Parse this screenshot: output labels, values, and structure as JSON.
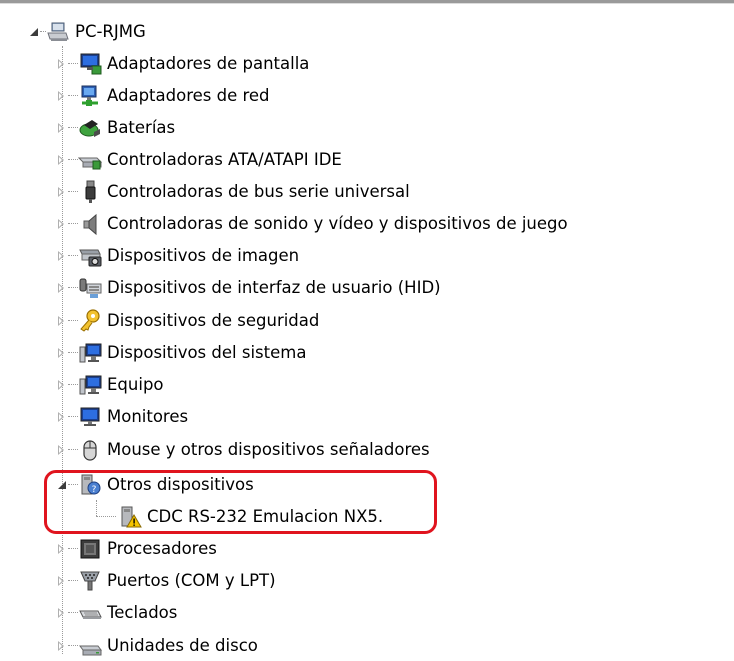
{
  "tree": {
    "root": {
      "label": "PC-RJMG",
      "icon": "computer-icon"
    },
    "categories": [
      {
        "label": "Adaptadores de pantalla",
        "icon": "display-adapter-icon"
      },
      {
        "label": "Adaptadores de red",
        "icon": "network-adapter-icon"
      },
      {
        "label": "Baterías",
        "icon": "battery-icon"
      },
      {
        "label": "Controladoras ATA/ATAPI IDE",
        "icon": "ide-controller-icon"
      },
      {
        "label": "Controladoras de bus serie universal",
        "icon": "usb-icon"
      },
      {
        "label": "Controladoras de sonido y vídeo y dispositivos de juego",
        "icon": "speaker-icon"
      },
      {
        "label": "Dispositivos de imagen",
        "icon": "camera-icon"
      },
      {
        "label": "Dispositivos de interfaz de usuario (HID)",
        "icon": "hid-icon"
      },
      {
        "label": "Dispositivos de seguridad",
        "icon": "key-icon"
      },
      {
        "label": "Dispositivos del sistema",
        "icon": "system-device-icon"
      },
      {
        "label": "Equipo",
        "icon": "computer-icon"
      },
      {
        "label": "Monitores",
        "icon": "monitor-icon"
      },
      {
        "label": "Mouse y otros dispositivos señaladores",
        "icon": "mouse-icon"
      },
      {
        "label": "Otros dispositivos",
        "icon": "unknown-device-icon",
        "expanded": true
      },
      {
        "label": "Procesadores",
        "icon": "processor-icon"
      },
      {
        "label": "Puertos (COM y LPT)",
        "icon": "port-icon"
      },
      {
        "label": "Teclados",
        "icon": "keyboard-icon"
      },
      {
        "label": "Unidades de disco",
        "icon": "disk-drive-icon"
      }
    ],
    "other_devices_child": {
      "label": "CDC RS-232 Emulacion NX5.",
      "icon": "warning-device-icon"
    }
  },
  "colors": {
    "highlight": "#e0141e",
    "warning": "#f5c400",
    "expander": "#b0b0b0"
  }
}
